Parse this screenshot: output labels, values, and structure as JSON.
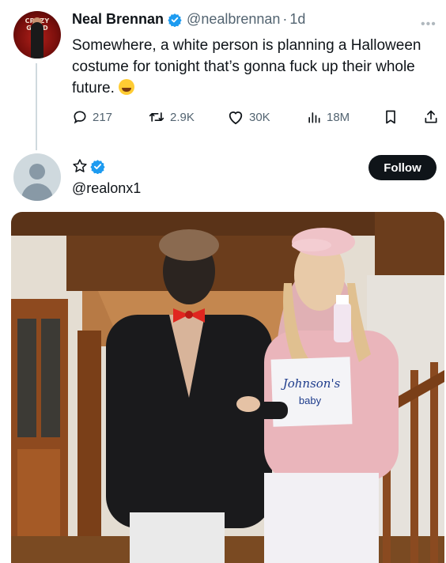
{
  "tweet": {
    "avatar_logo_text": "CRAZY GOOD",
    "display_name": "Neal Brennan",
    "handle": "@nealbrennan",
    "separator": "·",
    "time": "1d",
    "more_icon": "more-horizontal-icon",
    "text": "Somewhere, a white person is planning a Halloween costume for tonight that’s gonna fuck up their whole future.",
    "emoji": "face-with-tears-of-joy",
    "actions": {
      "replies": "217",
      "reposts": "2.9K",
      "likes": "30K",
      "views": "18M"
    }
  },
  "embedded": {
    "handle": "@realonx1",
    "follow_label": "Follow",
    "sign_text_line1": "Johnson's",
    "sign_text_line2": "baby"
  },
  "colors": {
    "verified_blue": "#1d9bf0",
    "text_secondary": "#536471",
    "follow_bg": "#0f1419"
  }
}
